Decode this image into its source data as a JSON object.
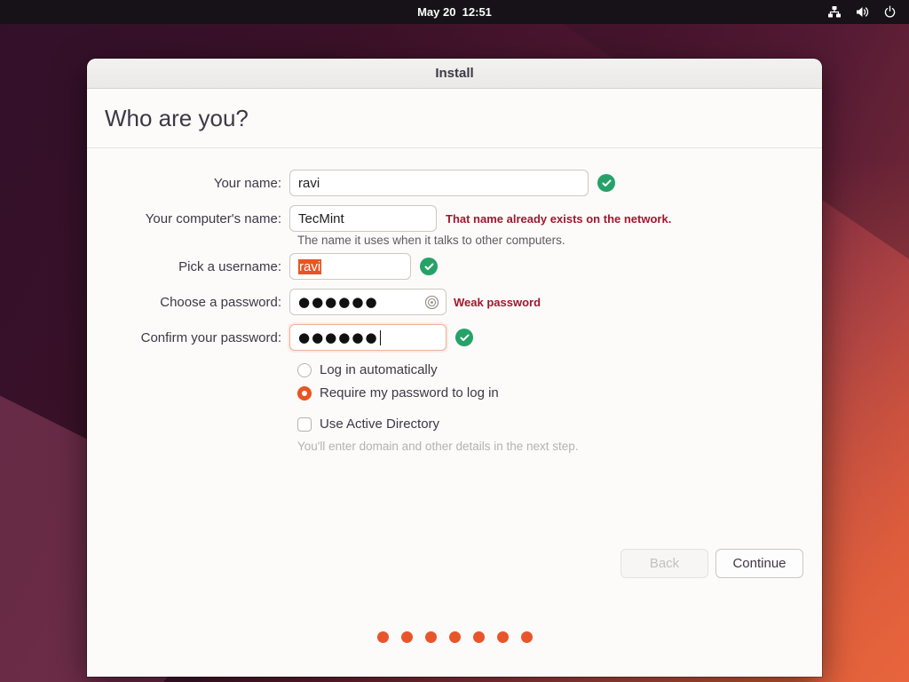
{
  "topbar": {
    "clock": "May 20  12:51",
    "icons": [
      {
        "name": "network-icon"
      },
      {
        "name": "volume-icon"
      },
      {
        "name": "power-icon"
      }
    ]
  },
  "window": {
    "title": "Install",
    "heading": "Who are you?",
    "form": {
      "name": {
        "label": "Your name:",
        "value": "ravi",
        "status": "valid"
      },
      "computer": {
        "label": "Your computer's name:",
        "value": "TecMint",
        "error": "That name already exists on the network.",
        "helper": "The name it uses when it talks to other computers."
      },
      "username": {
        "label": "Pick a username:",
        "value": "ravi",
        "selected": true,
        "status": "valid"
      },
      "password": {
        "label": "Choose a password:",
        "value": "●●●●●●",
        "warning": "Weak password"
      },
      "confirm": {
        "label": "Confirm your password:",
        "value": "●●●●●●",
        "status": "valid",
        "focused": true
      },
      "login_options": [
        {
          "label": "Log in automatically",
          "checked": false
        },
        {
          "label": "Require my password to log in",
          "checked": true
        }
      ],
      "active_directory": {
        "label": "Use Active Directory",
        "checked": false,
        "helper": "You'll enter domain and other details in the next step."
      }
    },
    "buttons": {
      "back": "Back",
      "continue": "Continue"
    },
    "progress": {
      "total_steps": 7
    }
  },
  "colors": {
    "accent_orange": "#e95420",
    "success_green": "#26a269",
    "error_red": "#a0182e",
    "topbar_bg": "#161217",
    "window_bg": "#fcfbfa"
  }
}
